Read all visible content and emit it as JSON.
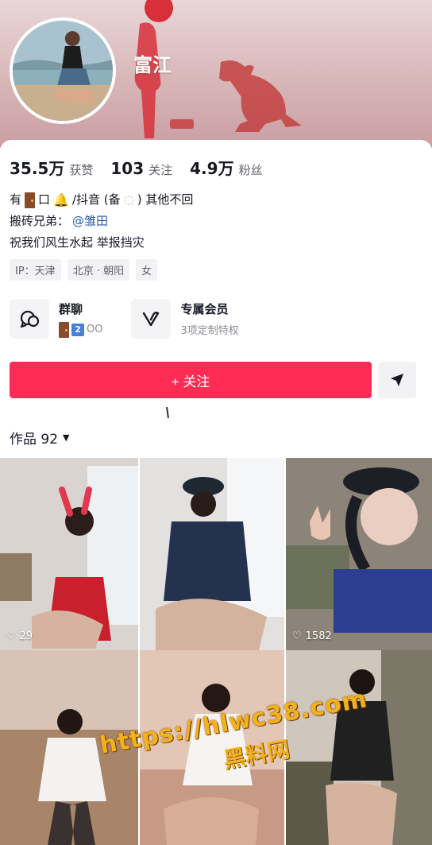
{
  "profile": {
    "nickname": "富江"
  },
  "stats": [
    {
      "value": "35.5万",
      "label": "获赞"
    },
    {
      "value": "103",
      "label": "关注"
    },
    {
      "value": "4.9万",
      "label": "粉丝"
    }
  ],
  "bio": {
    "line1_a": "有",
    "line1_b": "口",
    "line1_c": "/抖音 (备",
    "line1_d": ") 其他不回",
    "line2_prefix": "搬砖兄弟：",
    "line2_mention": "@雏田",
    "line3": "祝我们风生水起  举报挡灾"
  },
  "tags": [
    "IP：天津",
    "北京 · 朝阳",
    "女"
  ],
  "tiles": {
    "group": {
      "title": "群聊",
      "sub_suffix": "OO",
      "num": "2"
    },
    "member": {
      "title": "专属会员",
      "sub": "3项定制特权"
    }
  },
  "actions": {
    "follow_label": "+ 关注"
  },
  "works": {
    "label": "作品 92"
  },
  "grid": [
    {
      "likes": "29"
    },
    {
      "likes": ""
    },
    {
      "likes": "1582"
    },
    {
      "likes": ""
    },
    {
      "likes": ""
    },
    {
      "likes": ""
    }
  ],
  "watermark": {
    "url": "https://hlwc38.com",
    "text": "黑料网"
  },
  "colors": {
    "accent": "#fe2c55",
    "mention": "#2a5faa",
    "watermark": "#f2b21b"
  }
}
